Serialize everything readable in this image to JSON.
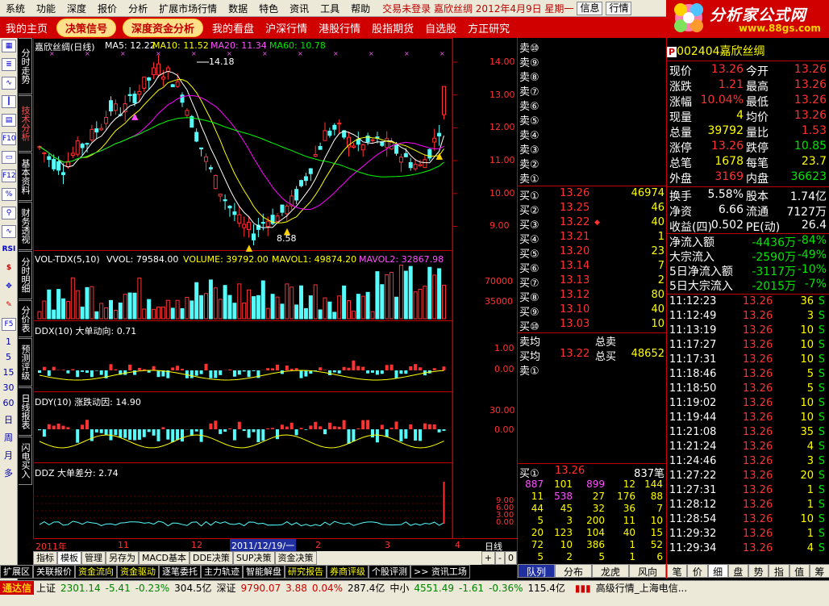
{
  "menu": {
    "items": [
      "系统",
      "功能",
      "深度",
      "报价",
      "分析",
      "扩展市场行情",
      "数据",
      "特色",
      "资讯",
      "工具",
      "帮助"
    ],
    "status": "交易未登录  嘉欣丝绸  2012年4月9日 星期一",
    "btn_info": "信息",
    "btn_hq": "行情"
  },
  "nav": {
    "home": "我的主页",
    "pill1": "决策信号",
    "pill2": "深度资金分析",
    "items": [
      "我的看盘",
      "沪深行情",
      "港股行情",
      "股指期货",
      "自选股",
      "方正研究"
    ]
  },
  "logo": {
    "title": "分析家公式网",
    "url": "www.88gs.com"
  },
  "vtabs": [
    "分时走势",
    "技术分析",
    "基本资料",
    "财务透视",
    "分时明细",
    "分价表",
    "预测评级",
    "日线报表",
    "闪电买入"
  ],
  "ltool_nums": [
    "1",
    "5",
    "15",
    "30",
    "60",
    "日",
    "周",
    "月",
    "多"
  ],
  "chart": {
    "title": "嘉欣丝绸(日线)",
    "ma5": "MA5: 12.22",
    "ma10": "MA10: 11.52",
    "ma20": "MA20: 11.34",
    "ma60": "MA60: 10.78",
    "high_label": "14.18",
    "low_label": "8.58",
    "price_ticks": [
      "14.00",
      "13.00",
      "12.00",
      "11.00",
      "10.00",
      "9.00"
    ],
    "vol_title": "VOL-TDX(5,10)",
    "vvol": "VVOL: 79584.00",
    "volume": "VOLUME: 39792.00",
    "mavol1": "MAVOL1: 49874.20",
    "mavol2": "MAVOL2: 32867.98",
    "vol_ticks": [
      "70000",
      "35000"
    ],
    "ddx_title": "DDX(10) 大单动向: 0.71",
    "ddx_ticks": [
      "1.00",
      "0.00"
    ],
    "ddy_title": "DDY(10) 涨跌动因: 14.90",
    "ddy_ticks": [
      "30.00",
      "0.00"
    ],
    "ddz_title": "DDZ 大单差分: 2.74",
    "ddz_ticks": [
      "9.00",
      "6.00",
      "3.00",
      "0.00"
    ],
    "dates": [
      "2011年",
      "11",
      "12",
      "2011/12/19/一",
      "2",
      "3",
      "4"
    ],
    "period": "日线",
    "zoom": [
      "+",
      "-",
      "0"
    ]
  },
  "chart_tabs": [
    "指标",
    "模板",
    "管理",
    "另存为",
    "MACD基本",
    "DDE决策",
    "SUP决策",
    "资金决策"
  ],
  "chart_tabs2": [
    "扩展区",
    "关联报价",
    "资金流向",
    "资金驱动",
    "逐笔委托",
    "主力轨迹",
    "智能解盘",
    "研究报告",
    "券商评级",
    "个股评测",
    ">> 资讯工场"
  ],
  "book": {
    "sells": [
      {
        "l": "卖⑩"
      },
      {
        "l": "卖⑨"
      },
      {
        "l": "卖⑧"
      },
      {
        "l": "卖⑦"
      },
      {
        "l": "卖⑥"
      },
      {
        "l": "卖⑤"
      },
      {
        "l": "卖④"
      },
      {
        "l": "卖③"
      },
      {
        "l": "卖②"
      },
      {
        "l": "卖①"
      }
    ],
    "buys": [
      {
        "l": "买①",
        "p": "13.26",
        "v": "46974"
      },
      {
        "l": "买②",
        "p": "13.25",
        "v": "46"
      },
      {
        "l": "买③",
        "p": "13.22",
        "v": "40"
      },
      {
        "l": "买④",
        "p": "13.21",
        "v": "1"
      },
      {
        "l": "买⑤",
        "p": "13.20",
        "v": "23"
      },
      {
        "l": "买⑥",
        "p": "13.14",
        "v": "7"
      },
      {
        "l": "买⑦",
        "p": "13.13",
        "v": "2"
      },
      {
        "l": "买⑧",
        "p": "13.12",
        "v": "80"
      },
      {
        "l": "买⑨",
        "p": "13.10",
        "v": "40"
      },
      {
        "l": "买⑩",
        "p": "13.03",
        "v": "10"
      }
    ],
    "avg_sell": "卖均",
    "total_sell": "总卖",
    "avg_buy": "买均",
    "avg_buy_p": "13.22",
    "total_buy": "总买",
    "total_buy_v": "48652",
    "sell1b": "卖①",
    "queue_label": "买①",
    "queue_price": "13.26",
    "queue_count": "837笔",
    "queue": [
      [
        "887",
        "101",
        "899",
        "12",
        "144"
      ],
      [
        "11",
        "538",
        "27",
        "176",
        "88"
      ],
      [
        "44",
        "45",
        "32",
        "36",
        "7"
      ],
      [
        "5",
        "3",
        "200",
        "11",
        "10"
      ],
      [
        "20",
        "123",
        "104",
        "40",
        "15"
      ],
      [
        "72",
        "10",
        "386",
        "1",
        "52"
      ],
      [
        "5",
        "2",
        "5",
        "1",
        "6"
      ]
    ],
    "tabs": [
      "队列",
      "分布",
      "龙虎",
      "风向"
    ]
  },
  "quote": {
    "code": "002404",
    "name": "嘉欣丝绸",
    "p_badge": "P",
    "rows": [
      [
        "现价",
        "13.26",
        "今开",
        "13.26"
      ],
      [
        "涨跌",
        "1.21",
        "最高",
        "13.26"
      ],
      [
        "涨幅",
        "10.04%",
        "最低",
        "13.26"
      ],
      [
        "现量",
        "4",
        "均价",
        "13.26"
      ],
      [
        "总量",
        "39792",
        "量比",
        "1.53"
      ],
      [
        "涨停",
        "13.26",
        "跌停",
        "10.85"
      ],
      [
        "总笔",
        "1678",
        "每笔",
        "23.7"
      ],
      [
        "外盘",
        "3169",
        "内盘",
        "36623"
      ]
    ],
    "rows2": [
      [
        "换手",
        "5.58%",
        "股本",
        "1.74亿"
      ],
      [
        "净资",
        "6.66",
        "流通",
        "7127万"
      ],
      [
        "收益(四)",
        "0.502",
        "PE(动)",
        "26.4"
      ]
    ],
    "flows": [
      [
        "净流入额",
        "-4436万",
        "-84%"
      ],
      [
        "大宗流入",
        "-2590万",
        "-49%"
      ],
      [
        "5日净流入额",
        "-3117万",
        "-10%"
      ],
      [
        "5日大宗流入",
        "-2015万",
        "-7%"
      ]
    ],
    "ticks": [
      [
        "11:12:23",
        "13.26",
        "36",
        "S"
      ],
      [
        "11:12:49",
        "13.26",
        "3",
        "S"
      ],
      [
        "11:13:19",
        "13.26",
        "10",
        "S"
      ],
      [
        "11:17:27",
        "13.26",
        "10",
        "S"
      ],
      [
        "11:17:31",
        "13.26",
        "10",
        "S"
      ],
      [
        "11:18:46",
        "13.26",
        "5",
        "S"
      ],
      [
        "11:18:50",
        "13.26",
        "5",
        "S"
      ],
      [
        "11:19:02",
        "13.26",
        "10",
        "S"
      ],
      [
        "11:19:44",
        "13.26",
        "10",
        "S"
      ],
      [
        "11:21:08",
        "13.26",
        "35",
        "S"
      ],
      [
        "11:21:24",
        "13.26",
        "4",
        "S"
      ],
      [
        "11:24:46",
        "13.26",
        "3",
        "S"
      ],
      [
        "11:27:22",
        "13.26",
        "20",
        "S"
      ],
      [
        "11:27:31",
        "13.26",
        "1",
        "S"
      ],
      [
        "11:28:12",
        "13.26",
        "1",
        "S"
      ],
      [
        "11:28:54",
        "13.26",
        "10",
        "S"
      ],
      [
        "11:29:32",
        "13.26",
        "1",
        "S"
      ],
      [
        "11:29:34",
        "13.26",
        "4",
        "S"
      ]
    ],
    "tabs": [
      "笔",
      "价",
      "细",
      "盘",
      "势",
      "指",
      "值",
      "筹"
    ]
  },
  "statusbar": {
    "brand": "通达信",
    "sh_label": "上证",
    "sh": "2301.14",
    "sh_chg": "-5.41",
    "sh_pct": "-0.23%",
    "sh_amt": "304.5亿",
    "sz_label": "深证",
    "sz": "9790.07",
    "sz_chg": "3.88",
    "sz_pct": "0.04%",
    "sz_amt": "287.4亿",
    "zx_label": "中小",
    "zx": "4551.49",
    "zx_chg": "-1.61",
    "zx_pct": "-0.36%",
    "zx_amt": "115.4亿",
    "right": "高级行情_上海电信..."
  },
  "colors": {
    "up": "#ff3232",
    "down": "#54fcfc",
    "ma5": "#ffffff",
    "ma10": "#ffff00",
    "ma20": "#ff00ff",
    "ma60": "#00ff00",
    "frame": "#c00000"
  }
}
